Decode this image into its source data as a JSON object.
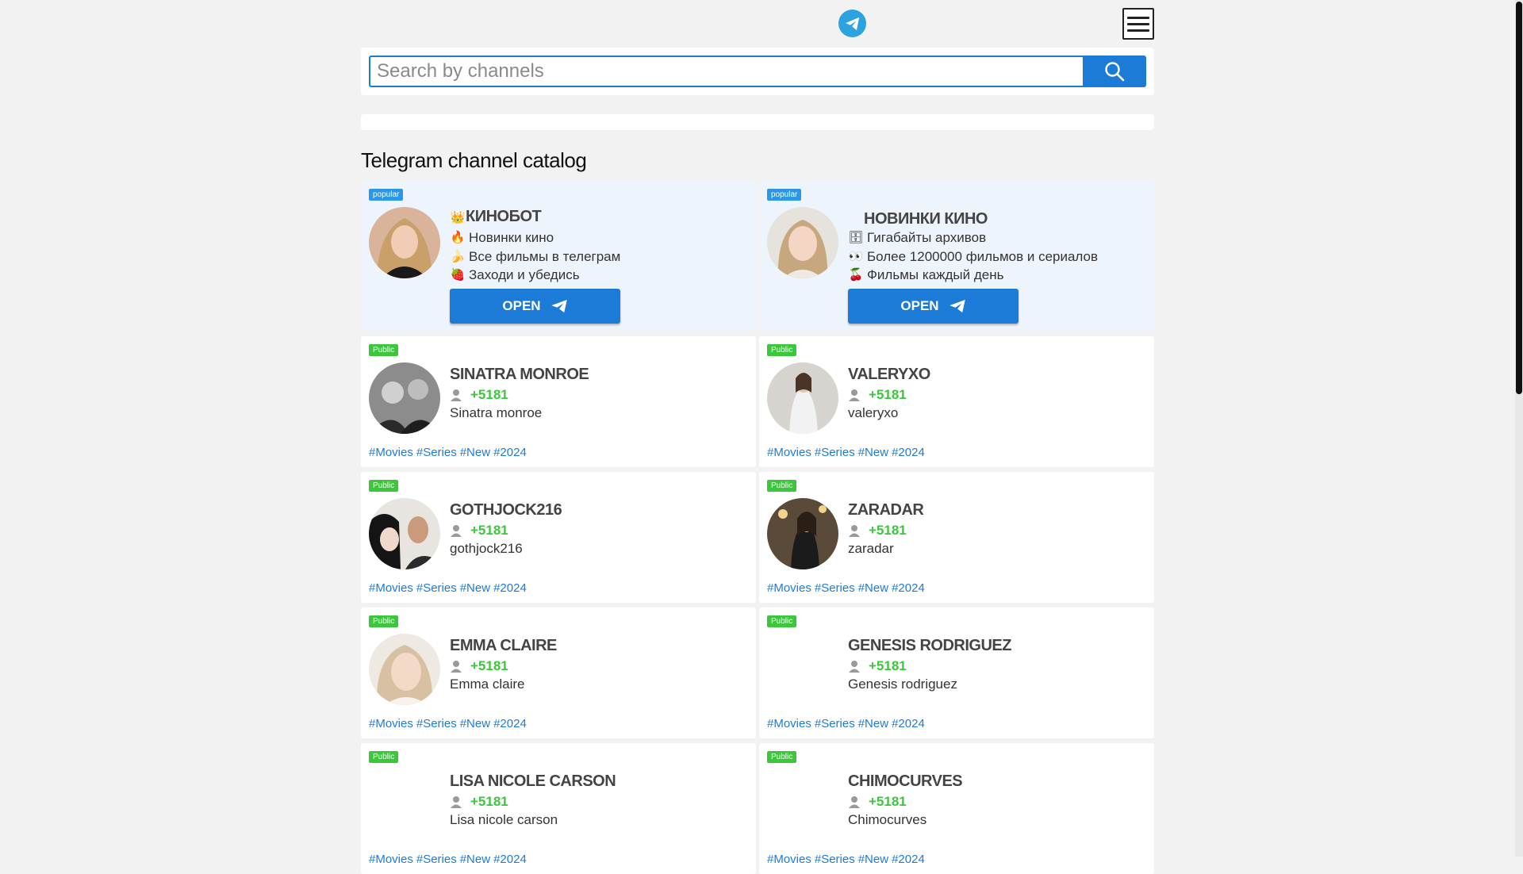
{
  "search": {
    "placeholder": "Search by channels"
  },
  "catalog_title": "Telegram channel catalog",
  "promo_cards": [
    {
      "badge": "popular",
      "name": "КИНОБОТ",
      "name_icon": "crown-icon",
      "lines": [
        {
          "icon": "fire-icon",
          "text": "Новинки кино"
        },
        {
          "icon": "banana-icon",
          "text": "Все фильмы в телеграм"
        },
        {
          "icon": "strawberry-icon",
          "text": "Заходи и убедись"
        }
      ],
      "button_label": "OPEN"
    },
    {
      "badge": "popular",
      "name": "НОВИНКИ КИНО",
      "name_icon": "",
      "lines": [
        {
          "icon": "file-cabinet-icon",
          "text": "Гигабайты архивов"
        },
        {
          "icon": "eyes-icon",
          "text": "Более 1200000 фильмов и сериалов"
        },
        {
          "icon": "cherries-icon",
          "text": "Фильмы каждый день"
        }
      ],
      "button_label": "OPEN"
    }
  ],
  "channels": [
    {
      "badge": "Public",
      "name": "SINATRA MONROE",
      "subscribers": "+5181",
      "description": "Sinatra monroe",
      "tags": [
        "#Movies",
        "#Series",
        "#New",
        "#2024"
      ],
      "has_avatar": true
    },
    {
      "badge": "Public",
      "name": "VALERYXO",
      "subscribers": "+5181",
      "description": "valeryxo",
      "tags": [
        "#Movies",
        "#Series",
        "#New",
        "#2024"
      ],
      "has_avatar": true
    },
    {
      "badge": "Public",
      "name": "GOTHJOCK216",
      "subscribers": "+5181",
      "description": "gothjock216",
      "tags": [
        "#Movies",
        "#Series",
        "#New",
        "#2024"
      ],
      "has_avatar": true
    },
    {
      "badge": "Public",
      "name": "ZARADAR",
      "subscribers": "+5181",
      "description": "zaradar",
      "tags": [
        "#Movies",
        "#Series",
        "#New",
        "#2024"
      ],
      "has_avatar": true
    },
    {
      "badge": "Public",
      "name": "EMMA CLAIRE",
      "subscribers": "+5181",
      "description": "Emma claire",
      "tags": [
        "#Movies",
        "#Series",
        "#New",
        "#2024"
      ],
      "has_avatar": true
    },
    {
      "badge": "Public",
      "name": "GENESIS RODRIGUEZ",
      "subscribers": "+5181",
      "description": "Genesis rodriguez",
      "tags": [
        "#Movies",
        "#Series",
        "#New",
        "#2024"
      ],
      "has_avatar": false
    },
    {
      "badge": "Public",
      "name": "LISA NICOLE CARSON",
      "subscribers": "+5181",
      "description": "Lisa nicole carson",
      "tags": [
        "#Movies",
        "#Series",
        "#New",
        "#2024"
      ],
      "has_avatar": false
    },
    {
      "badge": "Public",
      "name": "CHIMOCURVES",
      "subscribers": "+5181",
      "description": "Chimocurves",
      "tags": [
        "#Movies",
        "#Series",
        "#New",
        "#2024"
      ],
      "has_avatar": false
    }
  ],
  "colors": {
    "accent": "#1d7bd8",
    "telegram": "#2aa3e0",
    "public_badge": "#3cc63c",
    "popular_badge": "#2c96e8",
    "promo_bg": "#eef4fb"
  }
}
